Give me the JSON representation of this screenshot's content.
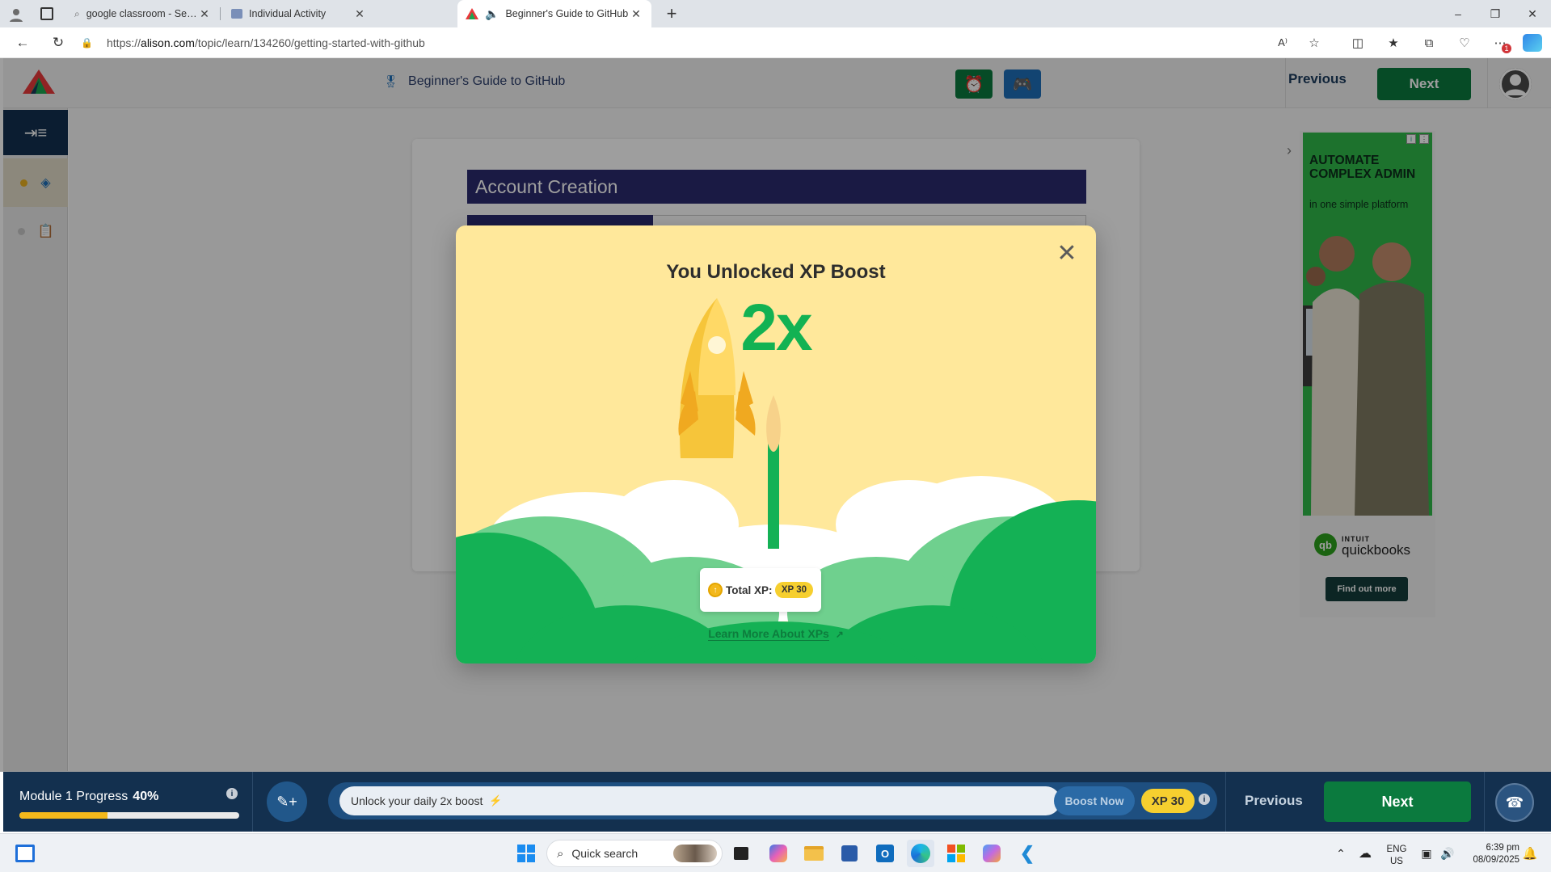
{
  "browser": {
    "tabs": [
      {
        "title": "google classroom - Search",
        "active": false
      },
      {
        "title": "Individual Activity",
        "active": false
      },
      {
        "title": "Beginner's Guide to GitHub",
        "active": true
      }
    ],
    "url_prefix": "https://",
    "url_host": "alison.com",
    "url_path": "/topic/learn/134260/getting-started-with-github",
    "notification_count": "1"
  },
  "header": {
    "course_title": "Beginner's Guide to GitHub",
    "previous_label": "Previous",
    "next_label": "Next",
    "accent_green": "#0b7a3e",
    "navy": "#13304f"
  },
  "slide": {
    "title": "Account Creation"
  },
  "ad": {
    "headline": "AUTOMATE COMPLEX ADMIN",
    "subline": "in one simple platform",
    "brand_top": "INTUIT",
    "brand": "quickbooks",
    "cta": "Find out more"
  },
  "modal": {
    "title": "You Unlocked XP Boost",
    "multiplier": "2x",
    "total_xp_label": "Total XP:",
    "total_xp_value": "XP 30",
    "learn_more": "Learn More About XPs",
    "background_color": "#ffe89b",
    "multiplier_color": "#12b253"
  },
  "bottom": {
    "module_label": "Module 1 Progress",
    "module_progress": "40%",
    "module_progress_fraction": 0.4,
    "boost_text": "Unlock your daily 2x boost",
    "boost_button": "Boost Now",
    "boost_xp": "XP 30",
    "previous_label": "Previous",
    "next_label": "Next"
  },
  "taskbar": {
    "search_placeholder": "Quick search",
    "lang_top": "ENG",
    "lang_bottom": "US",
    "time": "6:39 pm",
    "date": "08/09/2025"
  }
}
